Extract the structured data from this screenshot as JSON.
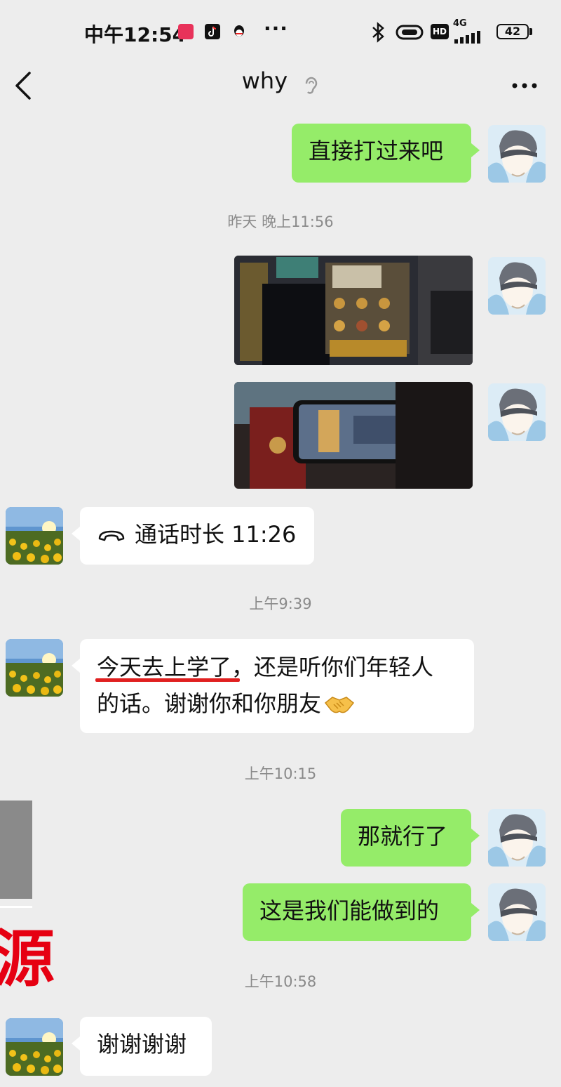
{
  "status_bar": {
    "time": "中午12:54",
    "network": "4G",
    "battery": "42",
    "more": "···",
    "hd": "HD"
  },
  "header": {
    "title": "why"
  },
  "messages": {
    "m1_text": "直接打过来吧",
    "ts1": "昨天 晚上11:56",
    "call_text": "通话时长 11:26",
    "ts2": "上午9:39",
    "m4_line1_underlined": "今天去上学了",
    "m4_line1_rest": "，还是听你们年轻人",
    "m4_line2": "的话。谢谢你和你朋友",
    "ts3": "上午10:15",
    "m5_text": "那就行了",
    "m6_text": "这是我们能做到的",
    "ts4": "上午10:58",
    "m7_text": "谢谢谢谢"
  },
  "overlay": {
    "char": "源"
  },
  "colors": {
    "background": "#ededed",
    "my_bubble": "#95ec69",
    "their_bubble": "#ffffff",
    "underline": "#e02020",
    "overlay_red": "#e60012"
  },
  "icons": [
    "back-arrow-icon",
    "ear-icon",
    "more-icon",
    "phone-icon",
    "handshake-emoji",
    "bluetooth-icon",
    "signal-icon",
    "battery-icon"
  ]
}
